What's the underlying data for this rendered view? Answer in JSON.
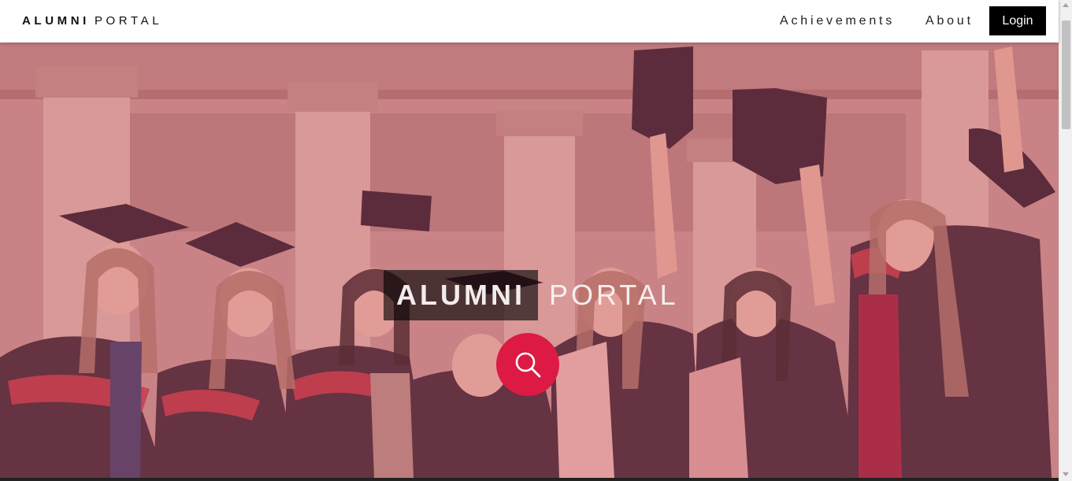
{
  "navbar": {
    "brand_strong": "ALUMNI",
    "brand_light": "PORTAL",
    "links": [
      "Achievements",
      "About"
    ],
    "login_label": "Login"
  },
  "hero": {
    "title_strong": "ALUMNI",
    "title_light": "PORTAL",
    "search_icon": "search-icon",
    "accent_color": "#dc1a43"
  }
}
